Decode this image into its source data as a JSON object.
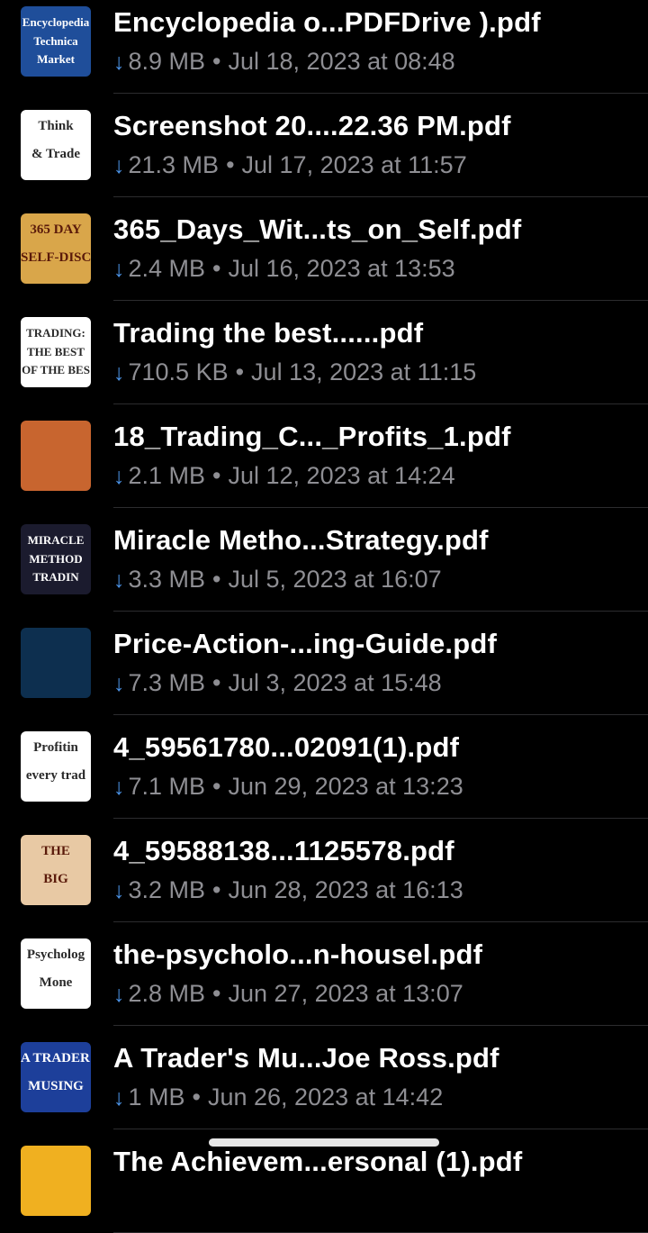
{
  "files": [
    {
      "title": "Encyclopedia o...PDFDrive ).pdf",
      "size": "8.9 MB",
      "date": "Jul 18, 2023 at 08:48",
      "thumb": "encyclopedia-technical-market-cover",
      "thumb_color": "#1f4e9a",
      "thumb_text": [
        "Encyclopedia",
        "Technica",
        "Market"
      ]
    },
    {
      "title": "Screenshot 20....22.36 PM.pdf",
      "size": "21.3 MB",
      "date": "Jul 17, 2023 at 11:57",
      "thumb": "think-and-trade-cover",
      "thumb_color": "#ffffff",
      "thumb_text": [
        "Think",
        "& Trade"
      ]
    },
    {
      "title": "365_Days_Wit...ts_on_Self.pdf",
      "size": "2.4 MB",
      "date": "Jul 16, 2023 at 13:53",
      "thumb": "365-days-self-discipline-cover",
      "thumb_color": "#d9a64a",
      "thumb_text": [
        "365 DAY",
        "SELF-DISCIPL"
      ]
    },
    {
      "title": "Trading the best......pdf",
      "size": "710.5 KB",
      "date": "Jul 13, 2023 at 11:15",
      "thumb": "trading-best-of-the-best-cover",
      "thumb_color": "#ffffff",
      "thumb_text": [
        "TRADING:",
        "THE BEST",
        "OF THE BES"
      ]
    },
    {
      "title": "18_Trading_C..._Profits_1.pdf",
      "size": "2.1 MB",
      "date": "Jul 12, 2023 at 14:24",
      "thumb": "trading-profits-cover",
      "thumb_color": "#c8652f",
      "thumb_text": []
    },
    {
      "title": "Miracle Metho...Strategy.pdf",
      "size": "3.3 MB",
      "date": "Jul 5, 2023 at 16:07",
      "thumb": "miracle-method-trading-cover",
      "thumb_color": "#1b1b2e",
      "thumb_text": [
        "MIRACLE",
        "METHOD",
        "TRADIN"
      ]
    },
    {
      "title": "Price-Action-...ing-Guide.pdf",
      "size": "7.3 MB",
      "date": "Jul 3, 2023 at 15:48",
      "thumb": "price-action-guide-cover",
      "thumb_color": "#0d2f4f",
      "thumb_text": []
    },
    {
      "title": "4_59561780...02091(1).pdf",
      "size": "7.1 MB",
      "date": "Jun 29, 2023 at 13:23",
      "thumb": "profiting-every-trade-cover",
      "thumb_color": "#ffffff",
      "thumb_text": [
        "Profitin",
        "every trad"
      ]
    },
    {
      "title": "4_59588138...1125578.pdf",
      "size": "3.2 MB",
      "date": "Jun 28, 2023 at 16:13",
      "thumb": "the-big-cover",
      "thumb_color": "#e8c9a4",
      "thumb_text": [
        "THE",
        "BIG"
      ]
    },
    {
      "title": "the-psycholo...n-housel.pdf",
      "size": "2.8 MB",
      "date": "Jun 27, 2023 at 13:07",
      "thumb": "psychology-of-money-cover",
      "thumb_color": "#ffffff",
      "thumb_text": [
        "Psycholog",
        "Mone"
      ]
    },
    {
      "title": "A Trader's Mu...Joe Ross.pdf",
      "size": "1 MB",
      "date": "Jun 26, 2023 at 14:42",
      "thumb": "a-traders-musings-cover",
      "thumb_color": "#1d3f9a",
      "thumb_text": [
        "A TRADER'",
        "MUSING"
      ]
    },
    {
      "title": "The Achievem...ersonal (1).pdf",
      "size": "",
      "date": "",
      "thumb": "achievement-cover",
      "thumb_color": "#f0b020",
      "thumb_text": []
    }
  ],
  "colors": {
    "background": "#000000",
    "title": "#ffffff",
    "meta": "#8e8e93",
    "download_arrow": "#4a90e2"
  },
  "icons": {
    "download": "download-arrow-icon",
    "separator": "•"
  }
}
